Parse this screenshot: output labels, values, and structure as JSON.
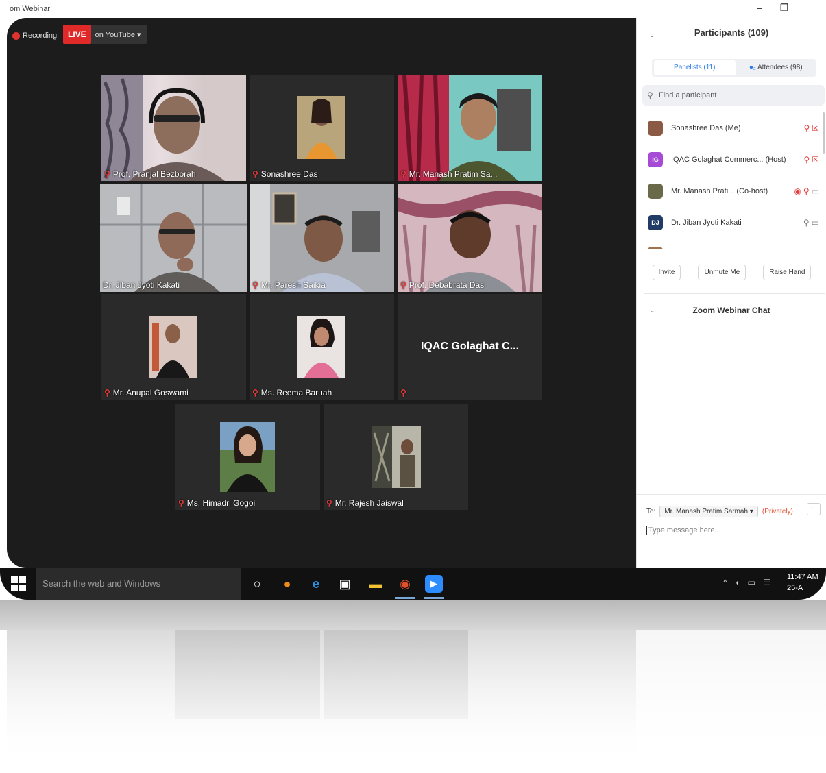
{
  "window": {
    "title": "om Webinar",
    "minimize": "–",
    "restore": "❐"
  },
  "toolbar": {
    "recording": "Recording",
    "live": "LIVE",
    "live_target": "on YouTube ▾"
  },
  "videos": [
    {
      "name": "Prof. Pranjal Bezborah",
      "muted": true
    },
    {
      "name": "Sonashree Das",
      "muted": true
    },
    {
      "name": "Mr. Manash Pratim Sa...",
      "muted": true
    },
    {
      "name": "Dr. Jiban Jyoti Kakati",
      "muted": false,
      "active": true
    },
    {
      "name": "Mr. Paresh Saikia",
      "muted": true
    },
    {
      "name": "Prof. Debabrata Das",
      "muted": true
    },
    {
      "name": "Mr. Anupal Goswami",
      "muted": true
    },
    {
      "name": "Ms. Reema Baruah",
      "muted": true
    },
    {
      "name": "",
      "muted": true,
      "display_name": "IQAC Golaghat C..."
    },
    {
      "name": "Ms. Himadri Gogoi",
      "muted": true
    },
    {
      "name": "Mr. Rajesh Jaiswal",
      "muted": true
    }
  ],
  "participants": {
    "title": "Participants (109)",
    "tabs": {
      "panelists": "Panelists (11)",
      "attendees": "Attendees (98)"
    },
    "search_placeholder": "Find a participant",
    "list": [
      {
        "name": "Sonashree Das (Me)",
        "avatar": "",
        "avatar_color": "#8a5a44",
        "status": "mic-off video-off"
      },
      {
        "name": "IQAC Golaghat Commerc... (Host)",
        "avatar": "IG",
        "avatar_color": "#a54bd6",
        "status": "mic-off video-off"
      },
      {
        "name": "Mr. Manash Prati... (Co-host)",
        "avatar": "",
        "avatar_color": "#6a6a4a",
        "status": "recording mic-off video"
      },
      {
        "name": "Dr. Jiban Jyoti Kakati",
        "avatar": "DJ",
        "avatar_color": "#1f3b66",
        "status": "mic video"
      }
    ],
    "buttons": {
      "invite": "Invite",
      "unmute": "Unmute Me",
      "raise": "Raise Hand"
    }
  },
  "chat": {
    "title": "Zoom Webinar Chat",
    "to_label": "To:",
    "to_value": "Mr. Manash Pratim Sarmah ▾",
    "privately": "(Privately)",
    "more": "···",
    "placeholder": "Type message here..."
  },
  "taskbar": {
    "search": "Search the web and Windows",
    "time": "11:47 AM",
    "date": "25-A"
  }
}
